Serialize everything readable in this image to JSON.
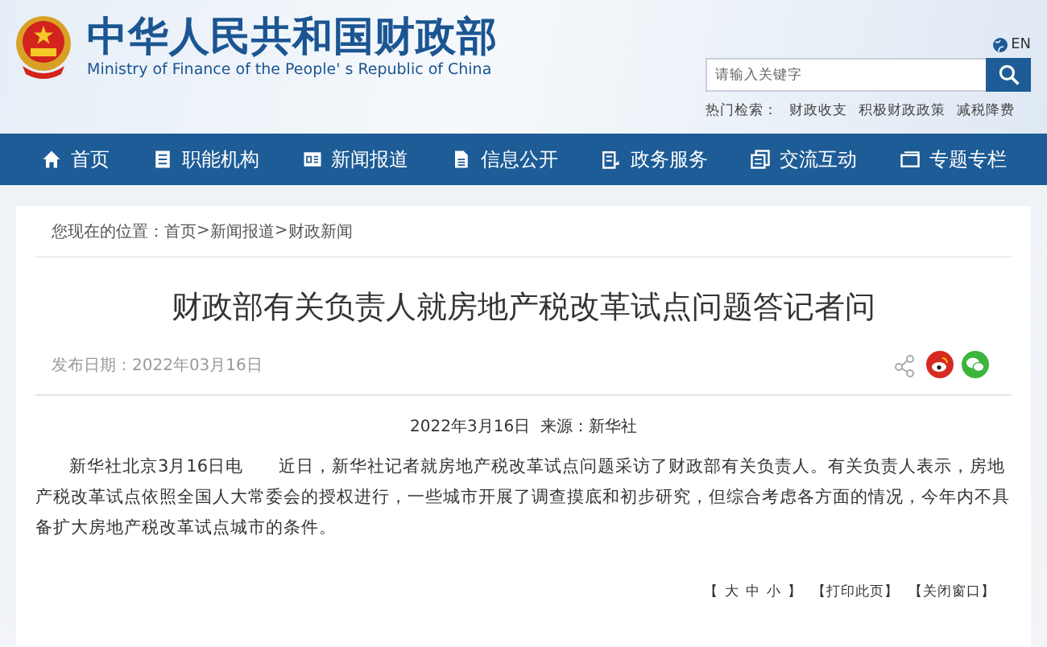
{
  "header": {
    "title": "中华人民共和国财政部",
    "subtitle": "Ministry of Finance of the People' s Republic of China",
    "language": "EN",
    "search": {
      "placeholder": "请输入关键字"
    },
    "hot_label": "热门检索：",
    "hot_links": [
      "财政收支",
      "积极财政政策",
      "减税降费"
    ]
  },
  "nav": [
    {
      "label": "首页"
    },
    {
      "label": "职能机构"
    },
    {
      "label": "新闻报道"
    },
    {
      "label": "信息公开"
    },
    {
      "label": "政务服务"
    },
    {
      "label": "交流互动"
    },
    {
      "label": "专题专栏"
    }
  ],
  "breadcrumb": {
    "label": "您现在的位置：",
    "links": [
      "首页",
      "新闻报道",
      "财政新闻"
    ],
    "separators": [
      ">",
      ">"
    ]
  },
  "article": {
    "title": "财政部有关负责人就房地产税改革试点问题答记者问",
    "date_label": "发布日期：",
    "date": "2022年03月16日",
    "meta": "2022年3月16日  来源：新华社",
    "body": "新华社北京3月16日电　　近日，新华社记者就房地产税改革试点问题采访了财政部有关负责人。有关负责人表示，房地产税改革试点依照全国人大常委会的授权进行，一些城市开展了调查摸底和初步研究，但综合考虑各方面的情况，今年内不具备扩大房地产税改革试点城市的条件。"
  },
  "tools": {
    "font_sizes": {
      "open": "【",
      "options": [
        "大",
        "中",
        "小"
      ],
      "close": "】"
    },
    "actions": [
      "【打印此页】",
      "【关闭窗口】"
    ]
  }
}
